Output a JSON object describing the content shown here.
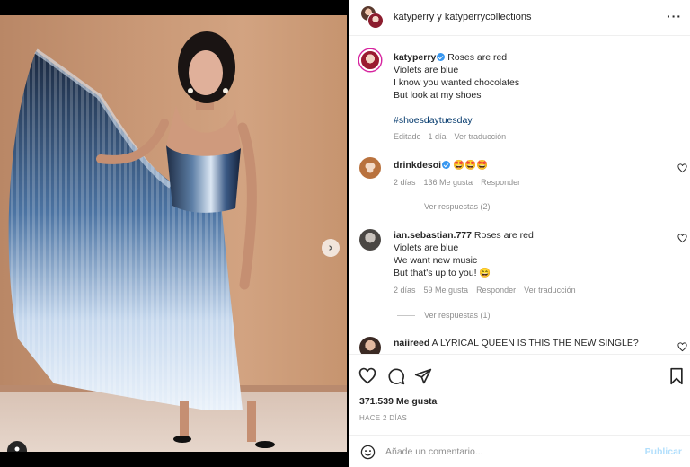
{
  "post": {
    "header_title": "katyperry y katyperrycollections",
    "caption_user": "katyperry",
    "caption_lines": [
      "Roses are red",
      "Violets are blue",
      "I know you wanted chocolates",
      "But look at my shoes"
    ],
    "hashtag": "#shoesdaytuesday",
    "caption_meta_edited": "Editado · 1 día",
    "caption_meta_translate": "Ver traducción"
  },
  "comments": [
    {
      "user": "drinkdesoi",
      "text": "🤩🤩🤩",
      "time": "2 días",
      "likes": "136 Me gusta",
      "reply": "Responder",
      "view_replies": "Ver respuestas (2)"
    },
    {
      "user": "ian.sebastian.777",
      "lines": [
        "Roses are red",
        "Violets are blue",
        "We want new music",
        "But that's up to you! 😄"
      ],
      "time": "2 días",
      "likes": "59 Me gusta",
      "reply": "Responder",
      "translate": "Ver traducción",
      "view_replies": "Ver respuestas (1)"
    },
    {
      "user": "naiireed",
      "text": "A LYRICAL QUEEN IS THIS THE NEW SINGLE?"
    }
  ],
  "stats": {
    "likes": "371.539 Me gusta",
    "ago": "HACE 2 DÍAS"
  },
  "comment_box": {
    "placeholder": "Añade un comentario...",
    "publish": "Publicar"
  },
  "icons": [
    "tag-user-icon",
    "chevron-right-icon",
    "more-icon",
    "heart-icon",
    "comment-icon",
    "share-icon",
    "save-icon",
    "emoji-icon"
  ],
  "colors": {
    "verified": "#3897f0",
    "hashtag": "#00376b",
    "publish": "#b2dffc"
  }
}
